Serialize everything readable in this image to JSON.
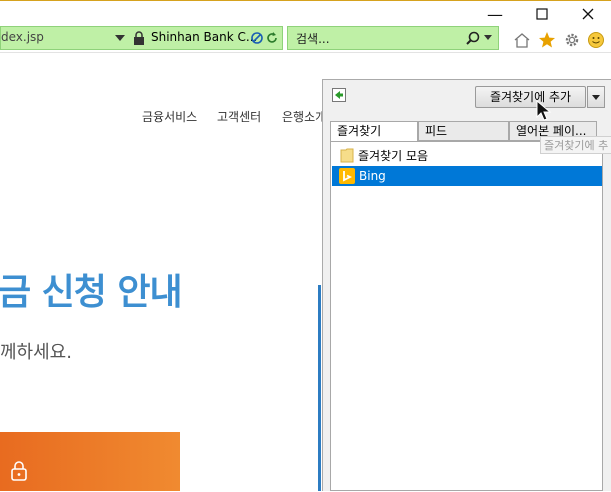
{
  "window": {
    "minimize_glyph": "—",
    "maximize_glyph": "☐",
    "close_glyph": "✕"
  },
  "address": {
    "url": "dex.jsp",
    "site_name": "Shinhan Bank C..."
  },
  "search": {
    "placeholder": "검색..."
  },
  "page": {
    "nav": [
      "금융서비스",
      "고객센터",
      "은행소개"
    ],
    "headline": "금 신청 안내",
    "subline": "께하세요."
  },
  "favorites": {
    "add_button": "즐겨찾기에 추가",
    "tabs": [
      "즐겨찾기",
      "피드",
      "열어본 페이..."
    ],
    "items": [
      {
        "label": "즐겨찾기 모음",
        "icon": "folder-icon",
        "selected": false
      },
      {
        "label": "Bing",
        "icon": "bing-icon",
        "selected": true
      }
    ],
    "tooltip": "즐겨찾기에 추"
  },
  "colors": {
    "address_bar": "#bff0a6",
    "selection": "#0078d7",
    "headline": "#3d8fd1",
    "orange": "#e86b20"
  }
}
